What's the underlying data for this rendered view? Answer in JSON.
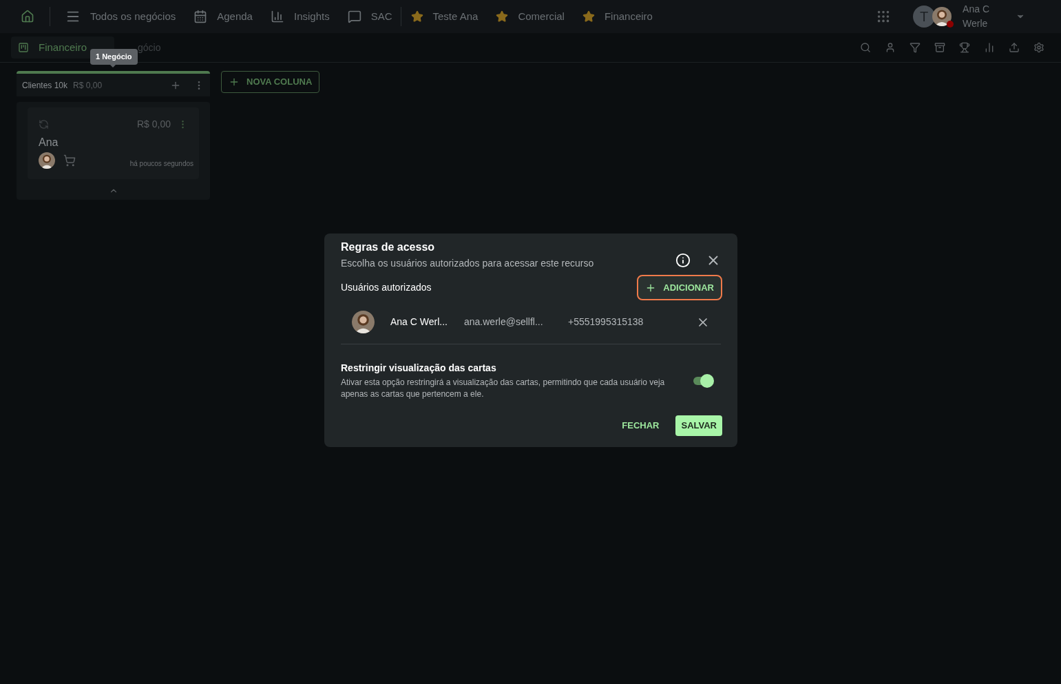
{
  "nav": {
    "items": [
      {
        "label": "Todos os negócios",
        "kind": "menu"
      },
      {
        "label": "Agenda",
        "kind": "calendar"
      },
      {
        "label": "Insights",
        "kind": "chart"
      },
      {
        "label": "SAC",
        "kind": "chat"
      },
      {
        "label": "Teste Ana",
        "kind": "star"
      },
      {
        "label": "Comercial",
        "kind": "star"
      },
      {
        "label": "Financeiro",
        "kind": "star"
      }
    ],
    "user": {
      "initial": "T",
      "name_lines": [
        "Ana C",
        "Werle"
      ]
    }
  },
  "subbar": {
    "tab": {
      "label": "Financeiro",
      "selected": true
    },
    "covered_text": "gócio",
    "tooltip": "1 Negócio"
  },
  "board": {
    "columns": [
      {
        "title": "Clientes 10k",
        "total": "R$ 0,00",
        "cards": [
          {
            "value": "R$ 0,00",
            "title": "Ana",
            "time": "há poucos segundos"
          }
        ]
      }
    ],
    "new_column": "NOVA COLUNA"
  },
  "dialog": {
    "title": "Regras de acesso",
    "subtitle": "Escolha os usuários autorizados para acessar este recurso",
    "section_label": "Usuários autorizados",
    "add_button": "ADICIONAR",
    "users": [
      {
        "name": "Ana C Werl...",
        "email": "ana.werle@sellfl...",
        "phone": "+5551995315138"
      }
    ],
    "restrict": {
      "title": "Restringir visualização das cartas",
      "description": "Ativar esta opção restringirá a visualização das cartas, permitindo que cada usuário veja apenas as cartas que pertencem a ele.",
      "on": true
    },
    "buttons": [
      {
        "label": "FECHAR",
        "kind": "text"
      },
      {
        "label": "SALVAR",
        "kind": "filled"
      }
    ]
  }
}
